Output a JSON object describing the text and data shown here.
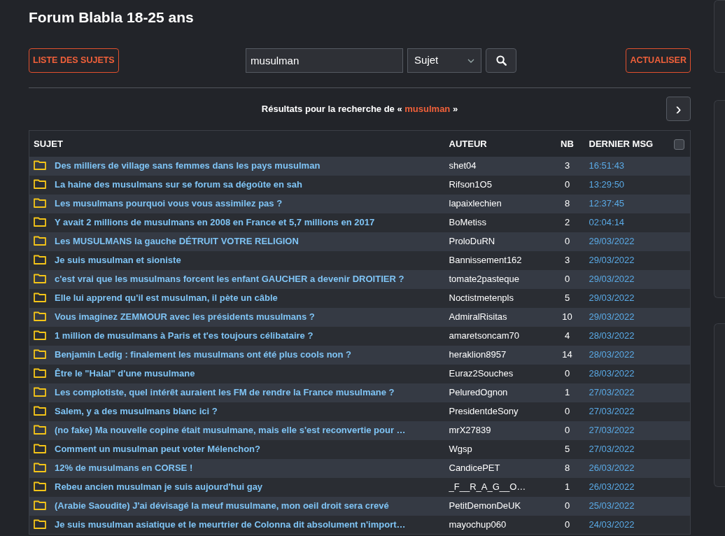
{
  "title": "Forum Blabla 18-25 ans",
  "toolbar": {
    "list_button": "LISTE DES SUJETS",
    "search": {
      "value": "musulman"
    },
    "search_scope": "Sujet",
    "refresh_button": "ACTUALISER"
  },
  "results": {
    "before": "Résultats pour la recherche de «",
    "term": "musulman",
    "after": "»",
    "next": "›"
  },
  "table": {
    "columns": [
      "SUJET",
      "AUTEUR",
      "NB",
      "DERNIER MSG"
    ],
    "select_all_checked": false,
    "rows": [
      {
        "subject": "Des milliers de village sans femmes dans les pays musulman",
        "author": "shet04",
        "count": "3",
        "last": "16:51:43"
      },
      {
        "subject": "La haine des musulmans sur se forum sa dégoûte en sah",
        "author": "Rifson1O5",
        "count": "0",
        "last": "13:29:50"
      },
      {
        "subject": "Les musulmans pourquoi vous vous assimilez pas ?",
        "author": "lapaixlechien",
        "count": "8",
        "last": "12:37:45"
      },
      {
        "subject": "Y avait 2 millions de musulmans en 2008 en France et 5,7 millions en 2017",
        "author": "BoMetiss",
        "count": "2",
        "last": "02:04:14"
      },
      {
        "subject": "Les MUSULMANS la gauche DÉTRUIT VOTRE RELIGION",
        "author": "ProloDuRN",
        "count": "0",
        "last": "29/03/2022"
      },
      {
        "subject": "Je suis musulman et sioniste",
        "author": "Bannissement162",
        "count": "3",
        "last": "29/03/2022"
      },
      {
        "subject": "c'est vrai que les musulmans forcent les enfant GAUCHER a devenir DROITIER ?",
        "author": "tomate2pasteque",
        "count": "0",
        "last": "29/03/2022"
      },
      {
        "subject": "Elle lui apprend qu'il est musulman, il pète un câble",
        "author": "Noctistmetenpls",
        "count": "5",
        "last": "29/03/2022"
      },
      {
        "subject": "Vous imaginez ZEMMOUR avec les présidents musulmans ?",
        "author": "AdmiralRisitas",
        "count": "10",
        "last": "29/03/2022"
      },
      {
        "subject": "1 million de musulmans à Paris et t'es toujours célibataire ?",
        "author": "amaretsoncam70",
        "count": "4",
        "last": "28/03/2022"
      },
      {
        "subject": "Benjamin Ledig : finalement les musulmans ont été plus cools non ?",
        "author": "heraklion8957",
        "count": "14",
        "last": "28/03/2022"
      },
      {
        "subject": "Être le \"Halal\" d'une musulmane",
        "author": "Euraz2Souches",
        "count": "0",
        "last": "28/03/2022"
      },
      {
        "subject": "Les complotiste, quel intérêt auraient les FM de rendre la France musulmane ?",
        "author": "PeluredOgnon",
        "count": "1",
        "last": "27/03/2022"
      },
      {
        "subject": "Salem, y a des musulmans blanc ici ?",
        "author": "PresidentdeSony",
        "count": "0",
        "last": "27/03/2022"
      },
      {
        "subject": "(no fake) Ma nouvelle copine était musulmane, mais elle s'est reconvertie pour …",
        "author": "mrX27839",
        "count": "0",
        "last": "27/03/2022"
      },
      {
        "subject": "Comment un musulman peut voter Mélenchon?",
        "author": "Wgsp",
        "count": "5",
        "last": "27/03/2022"
      },
      {
        "subject": "12% de musulmans en CORSE !",
        "author": "CandicePET",
        "count": "8",
        "last": "26/03/2022"
      },
      {
        "subject": "Rebeu ancien musulman je suis aujourd'hui gay",
        "author": "_F__R_A_G__O…",
        "count": "1",
        "last": "26/03/2022"
      },
      {
        "subject": "(Arabie Saoudite) J'ai dévisagé la meuf musulmane, mon oeil droit sera crevé",
        "author": "PetitDemonDeUK",
        "count": "0",
        "last": "25/03/2022"
      },
      {
        "subject": "Je suis musulman asiatique et le meurtrier de Colonna dit absolument n'import…",
        "author": "mayochup060",
        "count": "0",
        "last": "24/03/2022"
      }
    ]
  }
}
